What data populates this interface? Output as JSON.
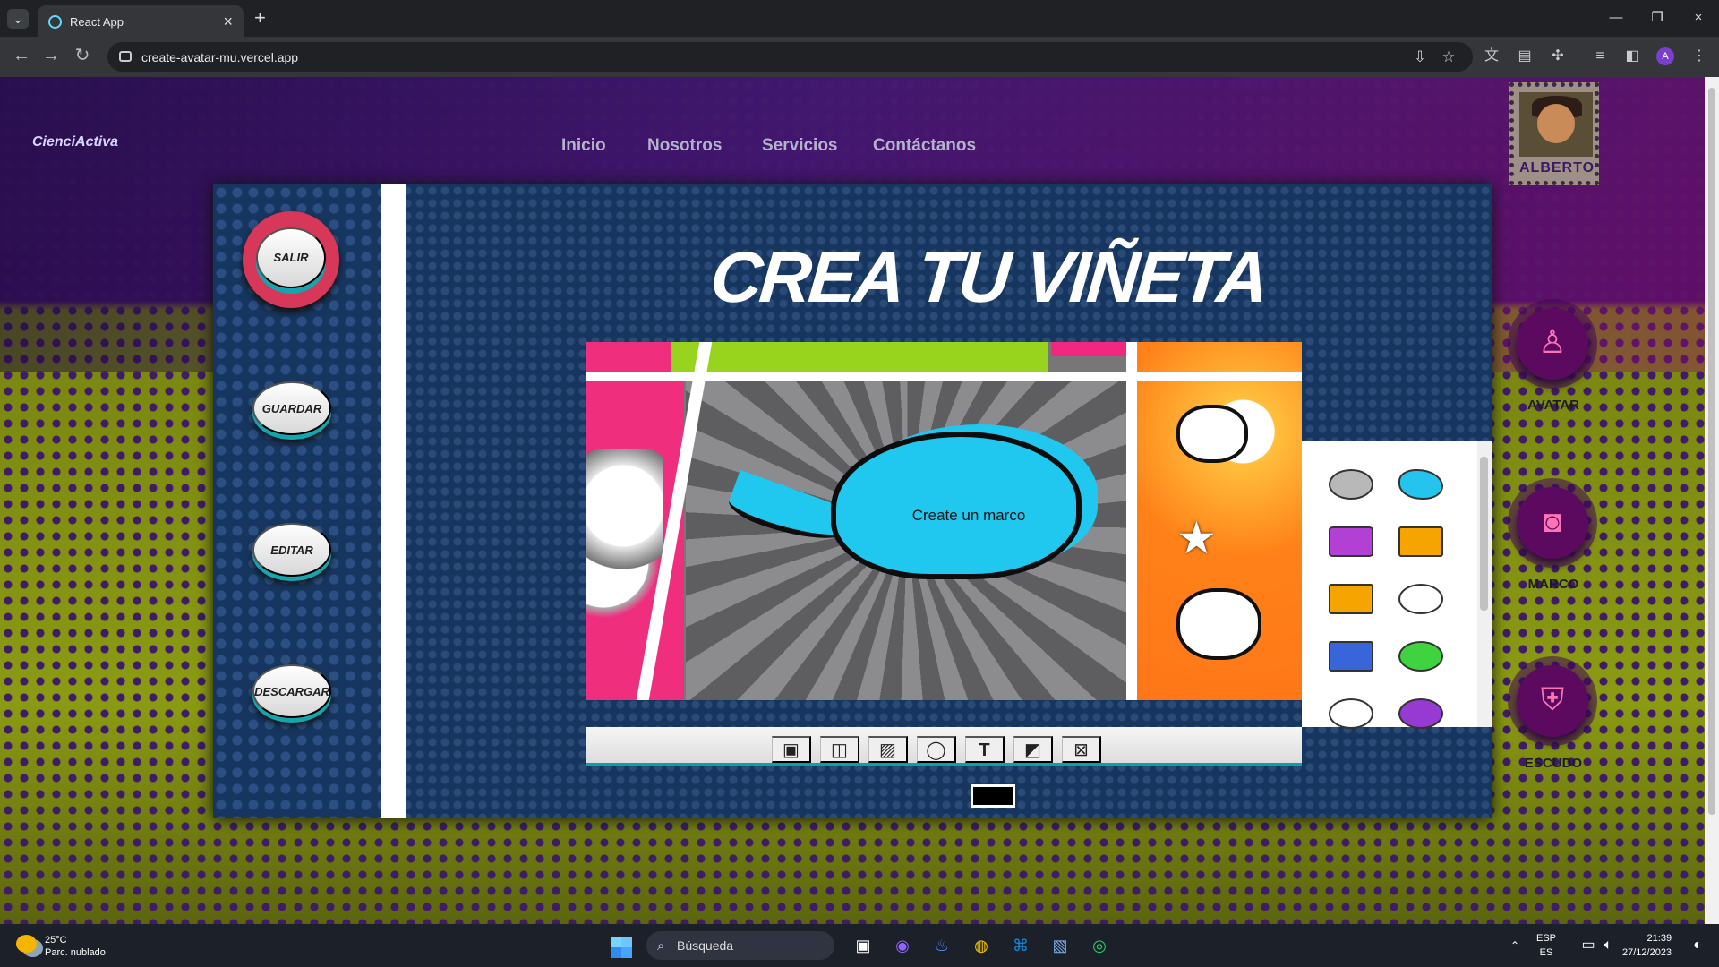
{
  "browser": {
    "tab_title": "React App",
    "url": "create-avatar-mu.vercel.app",
    "profile_initial": "A"
  },
  "site": {
    "logo": "CienciActiva",
    "nav": [
      "Inicio",
      "Nosotros",
      "Servicios",
      "Contáctanos"
    ],
    "stamp_name": "ALBERTO",
    "side_actions": [
      {
        "label": "AVATAR",
        "icon": "user-icon"
      },
      {
        "label": "MARCO",
        "icon": "camera-frame-icon"
      },
      {
        "label": "ESCUDO",
        "icon": "shield-icon"
      }
    ]
  },
  "editor": {
    "left_buttons": [
      "SALIR",
      "GUARDAR",
      "EDITAR",
      "DESCARGAR"
    ],
    "title": "CREA TU VIÑETA",
    "bubble_text": "Create un marco",
    "tools": [
      "camera-icon",
      "layout-icon",
      "pattern-icon",
      "speech-bubble-icon",
      "text-icon",
      "sticker-icon",
      "clear-icon"
    ],
    "tool_glyphs": [
      "▣",
      "◫",
      "▨",
      "◯",
      "T",
      "◩",
      "⊠"
    ],
    "selected_color": "#000000",
    "stickers": [
      "gray-oval-bubble",
      "blue-cloud-bubble",
      "purple-burst-bubble",
      "orange-rect-bubble",
      "orange-shout-bubble",
      "white-cloud-bubble",
      "blue-rect-bubble",
      "green-oval-bubble",
      "white-thought-bubble",
      "purple-cloud-bubble"
    ]
  },
  "taskbar": {
    "temperature": "25°C",
    "weather": "Parc. nublado",
    "search_placeholder": "Búsqueda",
    "language_top": "ESP",
    "language_bottom": "ES",
    "time": "21:39",
    "date": "27/12/2023"
  },
  "colors": {
    "modal": "#17365f",
    "accent": "#0aa1aa",
    "salir": "#d73758",
    "bubble": "#20c8ef",
    "side_button": "#5b0a60"
  }
}
